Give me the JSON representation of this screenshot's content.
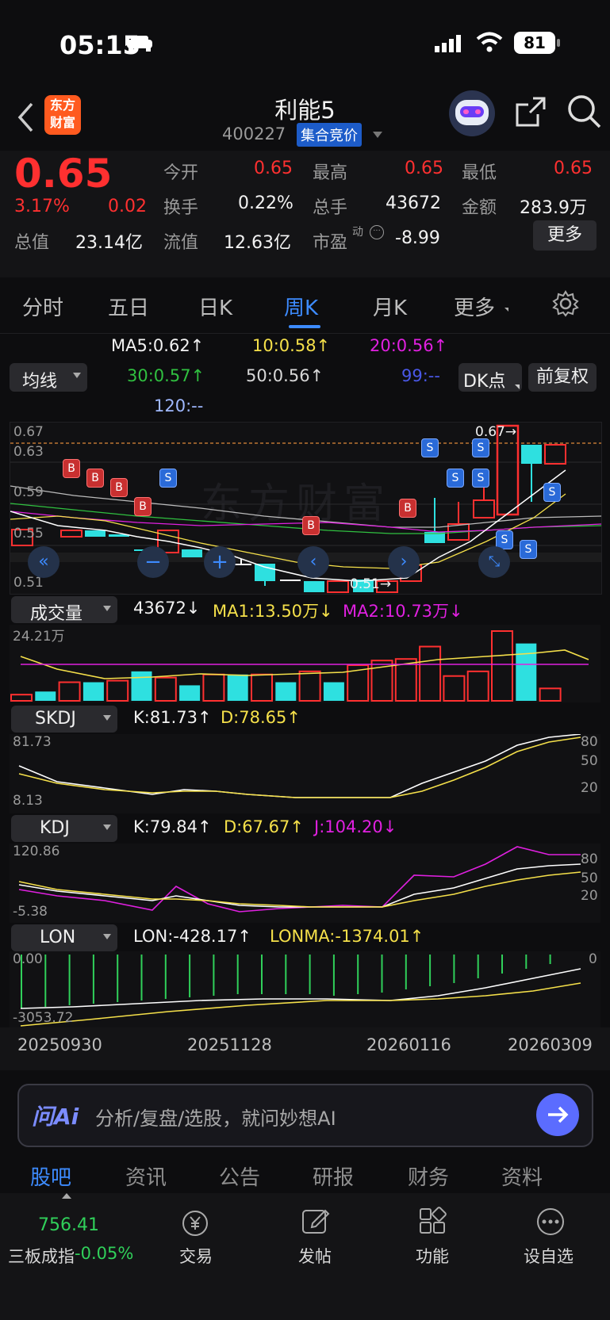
{
  "status": {
    "time": "05:15",
    "battery": "81"
  },
  "header": {
    "logo_line1": "东方",
    "logo_line2": "财富",
    "title": "利能5",
    "code": "400227",
    "badge": "集合竞价"
  },
  "quote": {
    "price": "0.65",
    "change_pct": "3.17%",
    "change": "0.02",
    "today_open_label": "今开",
    "today_open": "0.65",
    "high_label": "最高",
    "high": "0.65",
    "low_label": "最低",
    "low": "0.65",
    "turnover_label": "换手",
    "turnover": "0.22%",
    "volume_label": "总手",
    "volume": "43672",
    "amount_label": "金额",
    "amount": "283.9万",
    "total_value_label": "总值",
    "total_value": "23.14亿",
    "float_value_label": "流值",
    "float_value": "12.63亿",
    "pe_label": "市盈",
    "pe_sup": "动",
    "pe": "-8.99",
    "more_button": "更多"
  },
  "tabs": [
    "分时",
    "五日",
    "日K",
    "周K",
    "月K",
    "更多"
  ],
  "ma": {
    "selector": "均线",
    "ma5": "MA5:0.62↑",
    "ma10": "10:0.58↑",
    "ma20": "20:0.56↑",
    "ma30": "30:0.57↑",
    "ma50": "50:0.56↑",
    "ma99": "99:--",
    "ma120": "120:--",
    "dk_button": "DK点",
    "fq_button": "前复权"
  },
  "kline": {
    "y_labels": [
      "0.67",
      "0.63",
      "0.59",
      "0.55",
      "0.51"
    ],
    "high_marker": "0.67→",
    "low_marker": "0.51→",
    "watermark": "东方财富"
  },
  "volume": {
    "selector": "成交量",
    "value": "43672↓",
    "ma1": "MA1:13.50万↓",
    "ma2": "MA2:10.73万↓",
    "y_max": "24.21万",
    "bars": [
      4,
      6,
      12,
      12,
      13,
      19,
      15,
      10,
      17,
      17,
      17,
      12,
      19,
      12,
      23,
      26,
      27,
      35,
      16,
      19,
      45,
      37,
      8
    ]
  },
  "skdj": {
    "selector": "SKDJ",
    "k": "K:81.73↑",
    "d": "D:78.65↑",
    "y_top": "81.73",
    "y_bottom": "8.13",
    "levels": [
      "80",
      "50",
      "20"
    ]
  },
  "kdj": {
    "selector": "KDJ",
    "k": "K:79.84↑",
    "d": "D:67.67↑",
    "j": "J:104.20↓",
    "y_top": "120.86",
    "y_bottom": "-5.38",
    "levels": [
      "80",
      "50",
      "20"
    ]
  },
  "lon": {
    "selector": "LON",
    "lon": "LON:-428.17↑",
    "lonma": "LONMA:-1374.01↑",
    "y_top": "0.00",
    "y_bottom": "-3053.72",
    "right_zero": "0"
  },
  "dates": [
    "20250930",
    "20251128",
    "20260116",
    "20260309"
  ],
  "ai": {
    "logo": "问Ai",
    "placeholder": "分析/复盘/选股，就问妙想AI"
  },
  "nav_top": [
    "股吧",
    "资讯",
    "公告",
    "研报",
    "财务",
    "资料"
  ],
  "bottom_nav": {
    "index_value": "756.41",
    "index_name": "三板成指",
    "index_change": "-0.05%",
    "trade": "交易",
    "post": "发帖",
    "func": "功能",
    "watch": "设自选"
  },
  "colors": {
    "up": "#ff3030",
    "down": "#30d05a",
    "accent": "#3d8bff",
    "cyan": "#2ee0e0",
    "yellow": "#f5e04a",
    "magenta": "#e020e0"
  }
}
